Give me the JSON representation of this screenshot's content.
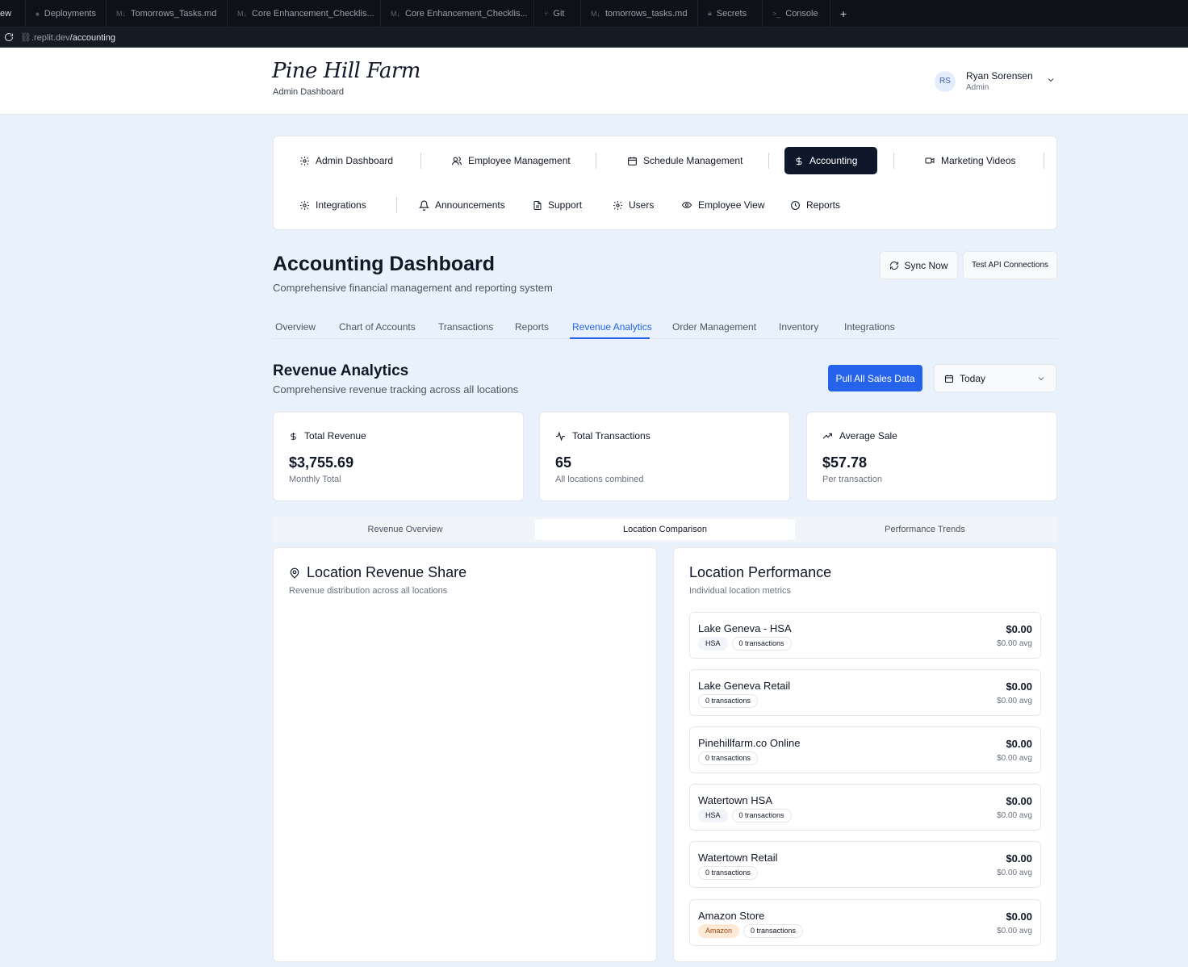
{
  "ide": {
    "tabs": [
      {
        "label": "ew"
      },
      {
        "label": "Deployments"
      },
      {
        "label": "Tomorrows_Tasks.md"
      },
      {
        "label": "Core Enhancement_Checklis..."
      },
      {
        "label": "Core Enhancement_Checklis..."
      },
      {
        "label": "Git"
      },
      {
        "label": "tomorrows_tasks.md"
      },
      {
        "label": "Secrets"
      },
      {
        "label": "Console"
      }
    ],
    "new_tab": "+",
    "url_host": ".replit.dev",
    "url_path": "/accounting"
  },
  "header": {
    "logo": "Pine Hill Farm",
    "subtitle": "Admin Dashboard",
    "user_initials": "RS",
    "user_name": "Ryan Sorensen",
    "user_role": "Admin"
  },
  "nav": {
    "row1": [
      "Admin Dashboard",
      "Employee Management",
      "Schedule Management",
      "Accounting",
      "Marketing Videos"
    ],
    "row2": [
      "Integrations",
      "Announcements",
      "Support",
      "Users",
      "Employee View",
      "Reports"
    ],
    "active": "Accounting"
  },
  "page": {
    "title": "Accounting Dashboard",
    "subtitle": "Comprehensive financial management and reporting system",
    "sync_button": "Sync Now",
    "test_button": "Test API Connections"
  },
  "subtabs": [
    "Overview",
    "Chart of Accounts",
    "Transactions",
    "Reports",
    "Revenue Analytics",
    "Order Management",
    "Inventory",
    "Integrations"
  ],
  "subtab_active": "Revenue Analytics",
  "revenue": {
    "title": "Revenue Analytics",
    "subtitle": "Comprehensive revenue tracking across all locations",
    "pull_button": "Pull All Sales Data",
    "range": "Today"
  },
  "stats": [
    {
      "label": "Total Revenue",
      "value": "$3,755.69",
      "note": "Monthly Total",
      "icon": "dollar-icon"
    },
    {
      "label": "Total Transactions",
      "value": "65",
      "note": "All locations combined",
      "icon": "activity-icon"
    },
    {
      "label": "Average Sale",
      "value": "$57.78",
      "note": "Per transaction",
      "icon": "trending-up-icon"
    }
  ],
  "view_tabs": [
    "Revenue Overview",
    "Location Comparison",
    "Performance Trends"
  ],
  "view_active": "Location Comparison",
  "share_panel": {
    "title": "Location Revenue Share",
    "subtitle": "Revenue distribution across all locations"
  },
  "perf_panel": {
    "title": "Location Performance",
    "subtitle": "Individual location metrics"
  },
  "locations": [
    {
      "name": "Lake Geneva - HSA",
      "tag": "HSA",
      "transactions": "0 transactions",
      "amount": "$0.00",
      "avg": "$0.00 avg"
    },
    {
      "name": "Lake Geneva Retail",
      "tag": "",
      "transactions": "0 transactions",
      "amount": "$0.00",
      "avg": "$0.00 avg"
    },
    {
      "name": "Pinehillfarm.co Online",
      "tag": "",
      "transactions": "0 transactions",
      "amount": "$0.00",
      "avg": "$0.00 avg"
    },
    {
      "name": "Watertown HSA",
      "tag": "HSA",
      "transactions": "0 transactions",
      "amount": "$0.00",
      "avg": "$0.00 avg"
    },
    {
      "name": "Watertown Retail",
      "tag": "",
      "transactions": "0 transactions",
      "amount": "$0.00",
      "avg": "$0.00 avg"
    },
    {
      "name": "Amazon Store",
      "tag": "Amazon",
      "transactions": "0 transactions",
      "amount": "$0.00",
      "avg": "$0.00 avg"
    }
  ],
  "colors": {
    "accent": "#2563eb",
    "nav_active": "#0f172a",
    "amazon_badge": "#fde9d6"
  }
}
